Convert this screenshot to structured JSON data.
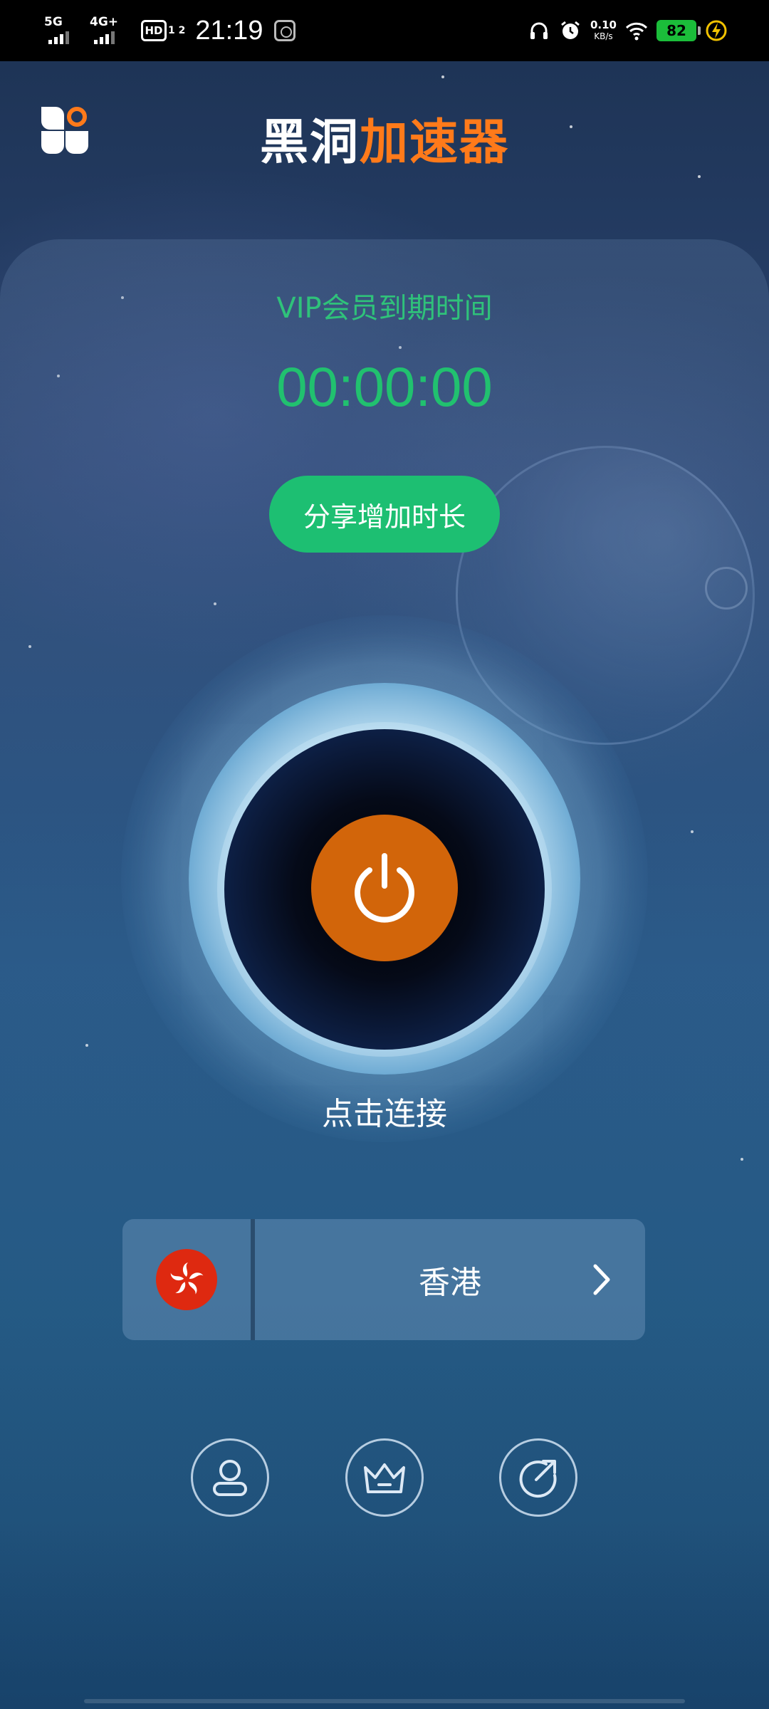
{
  "status_bar": {
    "signal1_label": "5G",
    "signal2_label": "4G+",
    "hd_label": "HD",
    "hd_sub": "1 2",
    "time": "21:19",
    "net_speed_value": "0.10",
    "net_speed_unit": "KB/s",
    "battery_level": "82"
  },
  "header": {
    "title_part1": "黑洞",
    "title_part2": "加速器"
  },
  "vip": {
    "label": "VIP会员到期时间",
    "time": "00:00:00",
    "share_button": "分享增加时长"
  },
  "connect": {
    "hint": "点击连接"
  },
  "server": {
    "name": "香港",
    "flag_icon": "hong-kong-flag-icon"
  },
  "bottom_nav": [
    {
      "icon": "user-icon"
    },
    {
      "icon": "crown-icon"
    },
    {
      "icon": "share-icon"
    }
  ],
  "colors": {
    "accent_green": "#1dbf72",
    "title_orange": "#ff7a1a",
    "power_orange": "#d2650a"
  }
}
